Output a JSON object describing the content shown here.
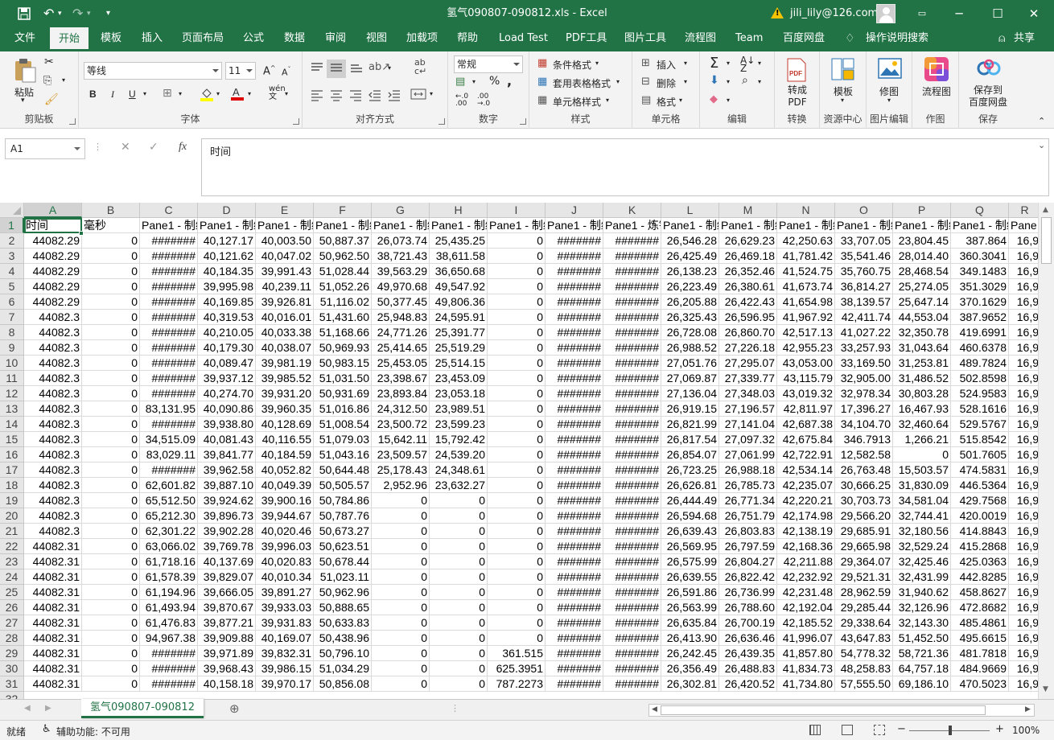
{
  "window": {
    "title": "氢气090807-090812.xls  -  Excel",
    "user": "jili_lily@126.com",
    "minimize": "─",
    "restore": "☐",
    "close": "✕"
  },
  "tabs": [
    "文件",
    "开始",
    "模板",
    "插入",
    "页面布局",
    "公式",
    "数据",
    "审阅",
    "视图",
    "加载项",
    "帮助",
    "Load Test",
    "PDF工具",
    "图片工具",
    "流程图",
    "Team",
    "百度网盘"
  ],
  "active_tab": "开始",
  "tell_me": "操作说明搜索",
  "share": "共享",
  "ribbon": {
    "clipboard": {
      "label": "剪贴板",
      "paste": "粘贴"
    },
    "font": {
      "label": "字体",
      "name": "等线",
      "size": "11"
    },
    "alignment": {
      "label": "对齐方式"
    },
    "number": {
      "label": "数字",
      "format": "常规"
    },
    "styles": {
      "label": "样式",
      "conditional": "条件格式",
      "table": "套用表格格式",
      "cell": "单元格样式"
    },
    "cells": {
      "label": "单元格",
      "insert": "插入",
      "delete": "删除",
      "format": "格式"
    },
    "editing": {
      "label": "编辑"
    },
    "convert": {
      "label": "转换",
      "btn": "转成\nPDF"
    },
    "resource": {
      "label": "资源中心",
      "btn": "模板"
    },
    "picedit": {
      "label": "图片编辑",
      "btn": "修图"
    },
    "drawing": {
      "label": "作图",
      "btn": "流程图"
    },
    "save": {
      "label": "保存",
      "btn": "保存到\n百度网盘"
    }
  },
  "namebox": "A1",
  "formula": "时间",
  "columns": [
    "A",
    "B",
    "C",
    "D",
    "E",
    "F",
    "G",
    "H",
    "I",
    "J",
    "K",
    "L",
    "M",
    "N",
    "O",
    "P",
    "Q",
    "R"
  ],
  "header_row": [
    "时间",
    "毫秒",
    "Pane1 - 制编",
    "Pane1 - 制编",
    "Pane1 - 制编",
    "Pane1 - 制编",
    "Pane1 - 制编",
    "Pane1 - 制编",
    "Pane1 - 制编",
    "Pane1 - 制编",
    "Pane1 - 炼钢",
    "Pane1 - 制编",
    "Pane1 - 制编",
    "Pane1 - 制编",
    "Pane1 - 制编",
    "Pane1 - 制编",
    "Pane1 - 制编",
    "Pane"
  ],
  "rows": [
    [
      "44082.29",
      "0",
      "#######",
      "40,127.17",
      "40,003.50",
      "50,887.37",
      "26,073.74",
      "25,435.25",
      "0",
      "#######",
      "#######",
      "26,546.28",
      "26,629.23",
      "42,250.63",
      "33,707.05",
      "23,804.45",
      "387.864",
      "16,9"
    ],
    [
      "44082.29",
      "0",
      "#######",
      "40,121.62",
      "40,047.02",
      "50,962.50",
      "38,721.43",
      "38,611.58",
      "0",
      "#######",
      "#######",
      "26,425.49",
      "26,469.18",
      "41,781.42",
      "35,541.46",
      "28,014.40",
      "360.3041",
      "16,9"
    ],
    [
      "44082.29",
      "0",
      "#######",
      "40,184.35",
      "39,991.43",
      "51,028.44",
      "39,563.29",
      "36,650.68",
      "0",
      "#######",
      "#######",
      "26,138.23",
      "26,352.46",
      "41,524.75",
      "35,760.75",
      "28,468.54",
      "349.1483",
      "16,9"
    ],
    [
      "44082.29",
      "0",
      "#######",
      "39,995.98",
      "40,239.11",
      "51,052.26",
      "49,970.68",
      "49,547.92",
      "0",
      "#######",
      "#######",
      "26,223.49",
      "26,380.61",
      "41,673.74",
      "36,814.27",
      "25,274.05",
      "351.3029",
      "16,9"
    ],
    [
      "44082.29",
      "0",
      "#######",
      "40,169.85",
      "39,926.81",
      "51,116.02",
      "50,377.45",
      "49,806.36",
      "0",
      "#######",
      "#######",
      "26,205.88",
      "26,422.43",
      "41,654.98",
      "38,139.57",
      "25,647.14",
      "370.1629",
      "16,9"
    ],
    [
      "44082.3",
      "0",
      "#######",
      "40,319.53",
      "40,016.01",
      "51,431.60",
      "25,948.83",
      "24,595.91",
      "0",
      "#######",
      "#######",
      "26,325.43",
      "26,596.95",
      "41,967.92",
      "42,411.74",
      "44,553.04",
      "387.9652",
      "16,9"
    ],
    [
      "44082.3",
      "0",
      "#######",
      "40,210.05",
      "40,033.38",
      "51,168.66",
      "24,771.26",
      "25,391.77",
      "0",
      "#######",
      "#######",
      "26,728.08",
      "26,860.70",
      "42,517.13",
      "41,027.22",
      "32,350.78",
      "419.6991",
      "16,9"
    ],
    [
      "44082.3",
      "0",
      "#######",
      "40,179.30",
      "40,038.07",
      "50,969.93",
      "25,414.65",
      "25,519.29",
      "0",
      "#######",
      "#######",
      "26,988.52",
      "27,226.18",
      "42,955.23",
      "33,257.93",
      "31,043.64",
      "460.6378",
      "16,9"
    ],
    [
      "44082.3",
      "0",
      "#######",
      "40,089.47",
      "39,981.19",
      "50,983.15",
      "25,453.05",
      "25,514.15",
      "0",
      "#######",
      "#######",
      "27,051.76",
      "27,295.07",
      "43,053.00",
      "33,169.50",
      "31,253.81",
      "489.7824",
      "16,9"
    ],
    [
      "44082.3",
      "0",
      "#######",
      "39,937.12",
      "39,985.52",
      "51,031.50",
      "23,398.67",
      "23,453.09",
      "0",
      "#######",
      "#######",
      "27,069.87",
      "27,339.77",
      "43,115.79",
      "32,905.00",
      "31,486.52",
      "502.8598",
      "16,9"
    ],
    [
      "44082.3",
      "0",
      "#######",
      "40,274.70",
      "39,931.20",
      "50,931.69",
      "23,893.84",
      "23,053.18",
      "0",
      "#######",
      "#######",
      "27,136.04",
      "27,348.03",
      "43,019.32",
      "32,978.34",
      "30,803.28",
      "524.9583",
      "16,9"
    ],
    [
      "44082.3",
      "0",
      "83,131.95",
      "40,090.86",
      "39,960.35",
      "51,016.86",
      "24,312.50",
      "23,989.51",
      "0",
      "#######",
      "#######",
      "26,919.15",
      "27,196.57",
      "42,811.97",
      "17,396.27",
      "16,467.93",
      "528.1616",
      "16,9"
    ],
    [
      "44082.3",
      "0",
      "#######",
      "39,938.80",
      "40,128.69",
      "51,008.54",
      "23,500.72",
      "23,599.23",
      "0",
      "#######",
      "#######",
      "26,821.99",
      "27,141.04",
      "42,687.38",
      "34,104.70",
      "32,460.64",
      "529.5767",
      "16,9"
    ],
    [
      "44082.3",
      "0",
      "34,515.09",
      "40,081.43",
      "40,116.55",
      "51,079.03",
      "15,642.11",
      "15,792.42",
      "0",
      "#######",
      "#######",
      "26,817.54",
      "27,097.32",
      "42,675.84",
      "346.7913",
      "1,266.21",
      "515.8542",
      "16,9"
    ],
    [
      "44082.3",
      "0",
      "83,029.11",
      "39,841.77",
      "40,184.59",
      "51,043.16",
      "23,509.57",
      "24,539.20",
      "0",
      "#######",
      "#######",
      "26,854.07",
      "27,061.99",
      "42,722.91",
      "12,582.58",
      "0",
      "501.7605",
      "16,9"
    ],
    [
      "44082.3",
      "0",
      "#######",
      "39,962.58",
      "40,052.82",
      "50,644.48",
      "25,178.43",
      "24,348.61",
      "0",
      "#######",
      "#######",
      "26,723.25",
      "26,988.18",
      "42,534.14",
      "26,763.48",
      "15,503.57",
      "474.5831",
      "16,9"
    ],
    [
      "44082.3",
      "0",
      "62,601.82",
      "39,887.10",
      "40,049.39",
      "50,505.57",
      "2,952.96",
      "23,632.27",
      "0",
      "#######",
      "#######",
      "26,626.81",
      "26,785.73",
      "42,235.07",
      "30,666.25",
      "31,830.09",
      "446.5364",
      "16,9"
    ],
    [
      "44082.3",
      "0",
      "65,512.50",
      "39,924.62",
      "39,900.16",
      "50,784.86",
      "0",
      "0",
      "0",
      "#######",
      "#######",
      "26,444.49",
      "26,771.34",
      "42,220.21",
      "30,703.73",
      "34,581.04",
      "429.7568",
      "16,9"
    ],
    [
      "44082.3",
      "0",
      "65,212.30",
      "39,896.73",
      "39,944.67",
      "50,787.76",
      "0",
      "0",
      "0",
      "#######",
      "#######",
      "26,594.68",
      "26,751.79",
      "42,174.98",
      "29,566.20",
      "32,744.41",
      "420.0019",
      "16,9"
    ],
    [
      "44082.3",
      "0",
      "62,301.22",
      "39,902.28",
      "40,020.46",
      "50,673.27",
      "0",
      "0",
      "0",
      "#######",
      "#######",
      "26,639.43",
      "26,803.83",
      "42,138.19",
      "29,685.91",
      "32,180.56",
      "414.8843",
      "16,9"
    ],
    [
      "44082.31",
      "0",
      "63,066.02",
      "39,769.78",
      "39,996.03",
      "50,623.51",
      "0",
      "0",
      "0",
      "#######",
      "#######",
      "26,569.95",
      "26,797.59",
      "42,168.36",
      "29,665.98",
      "32,529.24",
      "415.2868",
      "16,9"
    ],
    [
      "44082.31",
      "0",
      "61,718.16",
      "40,137.69",
      "40,020.83",
      "50,678.44",
      "0",
      "0",
      "0",
      "#######",
      "#######",
      "26,575.99",
      "26,804.27",
      "42,211.88",
      "29,364.07",
      "32,425.46",
      "425.0363",
      "16,9"
    ],
    [
      "44082.31",
      "0",
      "61,578.39",
      "39,829.07",
      "40,010.34",
      "51,023.11",
      "0",
      "0",
      "0",
      "#######",
      "#######",
      "26,639.55",
      "26,822.42",
      "42,232.92",
      "29,521.31",
      "32,431.99",
      "442.8285",
      "16,9"
    ],
    [
      "44082.31",
      "0",
      "61,194.96",
      "39,666.05",
      "39,891.27",
      "50,962.96",
      "0",
      "0",
      "0",
      "#######",
      "#######",
      "26,591.86",
      "26,736.99",
      "42,231.48",
      "28,962.59",
      "31,940.62",
      "458.8627",
      "16,9"
    ],
    [
      "44082.31",
      "0",
      "61,493.94",
      "39,870.67",
      "39,933.03",
      "50,888.65",
      "0",
      "0",
      "0",
      "#######",
      "#######",
      "26,563.99",
      "26,788.60",
      "42,192.04",
      "29,285.44",
      "32,126.96",
      "472.8682",
      "16,9"
    ],
    [
      "44082.31",
      "0",
      "61,476.83",
      "39,877.21",
      "39,931.83",
      "50,633.83",
      "0",
      "0",
      "0",
      "#######",
      "#######",
      "26,635.84",
      "26,700.19",
      "42,185.52",
      "29,338.64",
      "32,143.30",
      "485.4861",
      "16,9"
    ],
    [
      "44082.31",
      "0",
      "94,967.38",
      "39,909.88",
      "40,169.07",
      "50,438.96",
      "0",
      "0",
      "0",
      "#######",
      "#######",
      "26,413.90",
      "26,636.46",
      "41,996.07",
      "43,647.83",
      "51,452.50",
      "495.6615",
      "16,9"
    ],
    [
      "44082.31",
      "0",
      "#######",
      "39,971.89",
      "39,832.31",
      "50,796.10",
      "0",
      "0",
      "361.515",
      "#######",
      "#######",
      "26,242.45",
      "26,439.35",
      "41,857.80",
      "54,778.32",
      "58,721.36",
      "481.7818",
      "16,9"
    ],
    [
      "44082.31",
      "0",
      "#######",
      "39,968.43",
      "39,986.15",
      "51,034.29",
      "0",
      "0",
      "625.3951",
      "#######",
      "#######",
      "26,356.49",
      "26,488.83",
      "41,834.73",
      "48,258.83",
      "64,757.18",
      "484.9669",
      "16,9"
    ],
    [
      "44082.31",
      "0",
      "#######",
      "40,158.18",
      "39,970.17",
      "50,856.08",
      "0",
      "0",
      "787.2273",
      "#######",
      "#######",
      "26,302.81",
      "26,420.52",
      "41,734.80",
      "57,555.50",
      "69,186.10",
      "470.5023",
      "16,9"
    ]
  ],
  "sheet_tab": "氢气090807-090812",
  "status": {
    "ready": "就绪",
    "accessibility": "辅助功能: 不可用",
    "zoom": "100%"
  }
}
